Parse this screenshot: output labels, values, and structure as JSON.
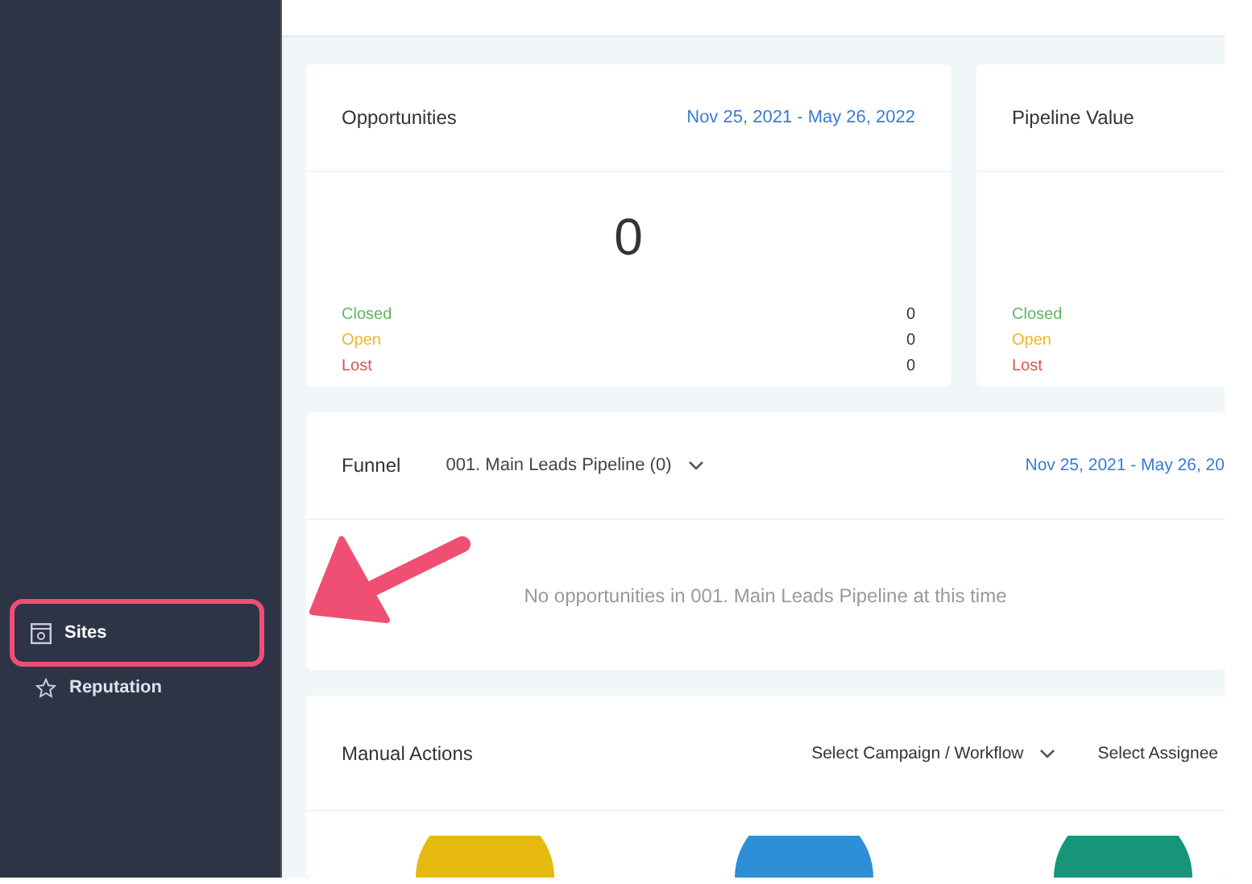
{
  "sidebar": {
    "items": [
      {
        "label": "Sites",
        "selected": true,
        "highlighted": true
      },
      {
        "label": "Reputation",
        "selected": false,
        "highlighted": false
      }
    ]
  },
  "stat_cards": [
    {
      "title": "Opportunities",
      "date_range": "Nov 25, 2021 - May 26, 2022",
      "total": "0",
      "rows": [
        {
          "label": "Closed",
          "value": "0",
          "color": "#5cb85c"
        },
        {
          "label": "Open",
          "value": "0",
          "color": "#f0b429"
        },
        {
          "label": "Lost",
          "value": "0",
          "color": "#d9534f"
        }
      ]
    },
    {
      "title": "Pipeline Value",
      "rows": [
        {
          "label": "Closed",
          "color": "#5cb85c"
        },
        {
          "label": "Open",
          "color": "#f0b429"
        },
        {
          "label": "Lost",
          "color": "#d9534f"
        }
      ]
    }
  ],
  "funnel": {
    "title": "Funnel",
    "pipeline": "001. Main Leads Pipeline (0)",
    "date_range": "Nov 25, 2021 - May 26, 20",
    "empty_message": "No opportunities in 001. Main Leads Pipeline at this time"
  },
  "manual_actions": {
    "title": "Manual Actions",
    "filters": [
      {
        "label": "Select Campaign / Workflow",
        "dropdown": true
      },
      {
        "label": "Select Assignee",
        "dropdown": false
      }
    ],
    "circles": [
      {
        "color": "#e6b90f"
      },
      {
        "color": "#2d8fd5"
      },
      {
        "color": "#16957a"
      }
    ]
  }
}
